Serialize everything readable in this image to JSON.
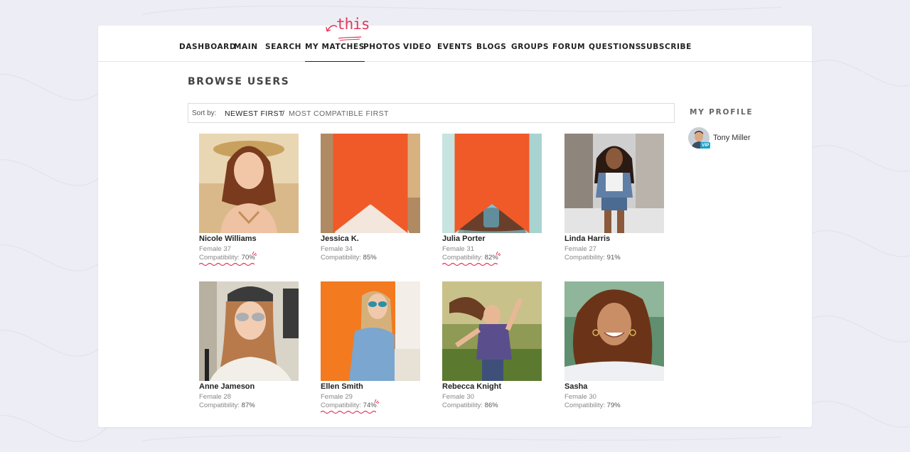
{
  "nav": {
    "items": [
      {
        "label": "DASHBOARD",
        "active": false
      },
      {
        "label": "MAIN",
        "active": false
      },
      {
        "label": "SEARCH",
        "active": false
      },
      {
        "label": "MY MATCHES",
        "active": true
      },
      {
        "label": "PHOTOS",
        "active": false
      },
      {
        "label": "VIDEO",
        "active": false
      },
      {
        "label": "EVENTS",
        "active": false
      },
      {
        "label": "BLOGS",
        "active": false
      },
      {
        "label": "GROUPS",
        "active": false
      },
      {
        "label": "FORUM",
        "active": false
      },
      {
        "label": "QUESTIONS",
        "active": false
      },
      {
        "label": "SUBSCRIBE",
        "active": false
      }
    ],
    "annotation": "this"
  },
  "page": {
    "title": "BROWSE USERS"
  },
  "sort": {
    "label": "Sort by:",
    "option_active": "NEWEST FIRST",
    "separator": "/",
    "option_other": "MOST COMPATIBLE FIRST"
  },
  "users": [
    {
      "name": "Nicole Williams",
      "meta": "Female 37",
      "compat_label": "Compatibility:",
      "compat": "70%",
      "bookmarked": false,
      "highlighted": true
    },
    {
      "name": "Jessica K.",
      "meta": "Female 34",
      "compat_label": "Compatibility:",
      "compat": "85%",
      "bookmarked": true,
      "highlighted": false
    },
    {
      "name": "Julia Porter",
      "meta": "Female 31",
      "compat_label": "Compatibility:",
      "compat": "82%",
      "bookmarked": true,
      "highlighted": true
    },
    {
      "name": "Linda Harris",
      "meta": "Female 27",
      "compat_label": "Compatibility:",
      "compat": "91%",
      "bookmarked": false,
      "highlighted": false
    },
    {
      "name": "Anne Jameson",
      "meta": "Female 28",
      "compat_label": "Compatibility:",
      "compat": "87%",
      "bookmarked": false,
      "highlighted": false
    },
    {
      "name": "Ellen Smith",
      "meta": "Female 29",
      "compat_label": "Compatibility:",
      "compat": "74%",
      "bookmarked": false,
      "highlighted": true
    },
    {
      "name": "Rebecca Knight",
      "meta": "Female 30",
      "compat_label": "Compatibility:",
      "compat": "86%",
      "bookmarked": false,
      "highlighted": false
    },
    {
      "name": "Sasha",
      "meta": "Female 30",
      "compat_label": "Compatibility:",
      "compat": "79%",
      "bookmarked": false,
      "highlighted": false
    }
  ],
  "sidebar": {
    "title": "MY PROFILE",
    "name": "Tony Miller",
    "badge": "VIP"
  },
  "colors": {
    "accent": "#e5365a",
    "bookmark": "#f05a28",
    "vip": "#1aa3c9"
  }
}
